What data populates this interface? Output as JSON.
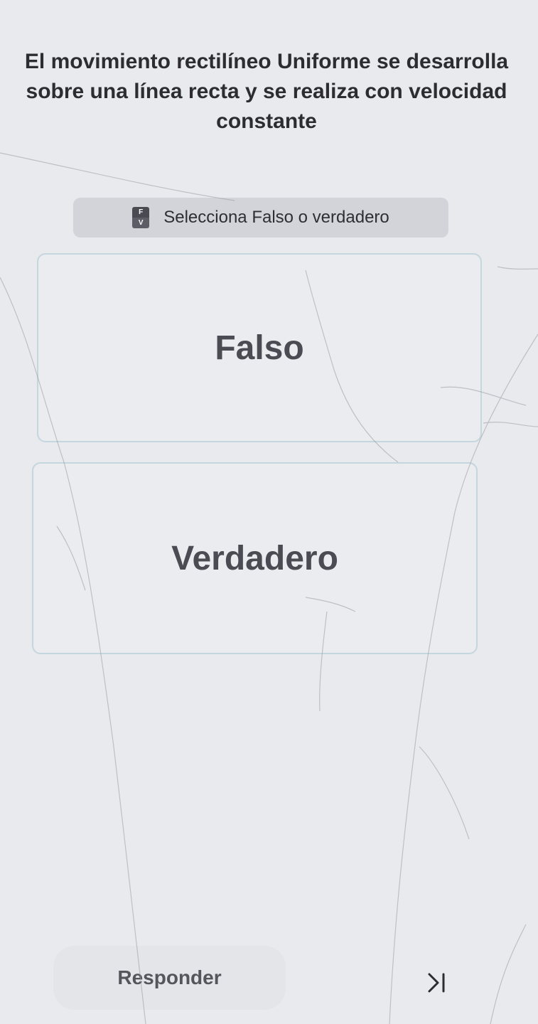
{
  "question": {
    "text": "El movimiento rectilíneo Uniforme se desarrolla sobre una línea recta y se realiza con velocidad constante"
  },
  "instruction": {
    "icon": "true-false-icon",
    "icon_top": "F",
    "icon_bottom": "V",
    "label": "Selecciona Falso o verdadero"
  },
  "options": [
    {
      "label": "Falso"
    },
    {
      "label": "Verdadero"
    }
  ],
  "footer": {
    "submit_label": "Responder",
    "skip_icon": "skip-to-end-icon"
  }
}
